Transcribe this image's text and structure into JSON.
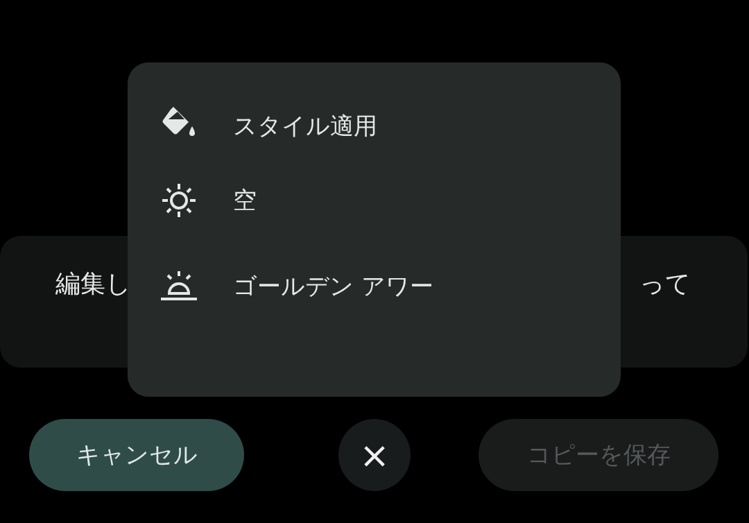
{
  "background_card": {
    "text_left": "編集し",
    "text_right": "って"
  },
  "menu": {
    "items": [
      {
        "kind": "style",
        "label": "スタイル適用"
      },
      {
        "kind": "sky",
        "label": "空"
      },
      {
        "kind": "golden_hour",
        "label": "ゴールデン アワー"
      }
    ]
  },
  "actions": {
    "cancel": {
      "label": "キャンセル"
    },
    "close": {
      "label": "×"
    },
    "save": {
      "label": "コピーを保存",
      "disabled": true
    }
  }
}
